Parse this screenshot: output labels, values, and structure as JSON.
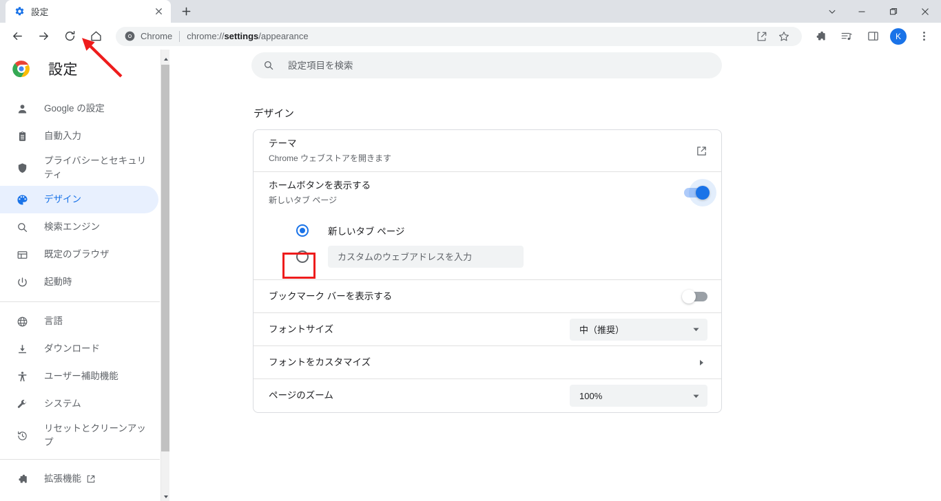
{
  "window": {
    "controls": {
      "tab_search": "tab-search",
      "minimize": "minimize",
      "maximize": "maximize",
      "close": "close"
    }
  },
  "tabstrip": {
    "tabs": [
      {
        "title": "設定",
        "favicon": "gear-icon",
        "active": true
      }
    ],
    "new_tab_label": "+",
    "close_label": "×"
  },
  "toolbar": {
    "back": "back-icon",
    "forward": "forward-icon",
    "reload": "reload-icon",
    "home": "home-icon",
    "omnibox": {
      "brand": "Chrome",
      "url_prefix": "chrome://",
      "url_bold": "settings",
      "url_suffix": "/appearance",
      "full_url": "chrome://settings/appearance"
    },
    "actions": {
      "share": "share-icon",
      "bookmark": "star-icon",
      "extensions": "puzzle-icon",
      "media": "media-list-icon",
      "side_panel": "side-panel-icon",
      "profile_initial": "K",
      "menu": "three-dot-menu-icon"
    }
  },
  "sidebar": {
    "brand_title": "設定",
    "groups": [
      {
        "items": [
          {
            "label": "Google の設定",
            "icon": "person-icon",
            "active": false
          },
          {
            "label": "自動入力",
            "icon": "clipboard-icon",
            "active": false
          },
          {
            "label": "プライバシーとセキュリティ",
            "icon": "shield-icon",
            "active": false
          },
          {
            "label": "デザイン",
            "icon": "palette-icon",
            "active": true
          },
          {
            "label": "検索エンジン",
            "icon": "search-icon",
            "active": false
          },
          {
            "label": "既定のブラウザ",
            "icon": "browser-window-icon",
            "active": false
          },
          {
            "label": "起動時",
            "icon": "power-icon",
            "active": false
          }
        ]
      },
      {
        "items": [
          {
            "label": "言語",
            "icon": "globe-icon",
            "active": false
          },
          {
            "label": "ダウンロード",
            "icon": "download-icon",
            "active": false
          },
          {
            "label": "ユーザー補助機能",
            "icon": "accessibility-icon",
            "active": false
          },
          {
            "label": "システム",
            "icon": "wrench-icon",
            "active": false
          },
          {
            "label": "リセットとクリーンアップ",
            "icon": "restore-icon",
            "active": false
          }
        ]
      },
      {
        "items": [
          {
            "label": "拡張機能",
            "icon": "puzzle-icon",
            "external": true,
            "active": false
          }
        ]
      }
    ]
  },
  "main": {
    "search": {
      "placeholder": "設定項目を検索",
      "value": "",
      "icon": "search-icon"
    },
    "section_title": "デザイン",
    "rows": {
      "theme": {
        "title": "テーマ",
        "subtitle": "Chrome ウェブストアを開きます",
        "action_icon": "external-link-icon"
      },
      "home_button": {
        "title": "ホームボタンを表示する",
        "subtitle": "新しいタブ ページ",
        "toggle_state": "on"
      },
      "home_options": {
        "option_new_tab": "新しいタブ ページ",
        "option_new_tab_selected": true,
        "option_custom_selected": false,
        "custom_placeholder": "カスタムのウェブアドレスを入力",
        "custom_value": ""
      },
      "bookmarks_bar": {
        "title": "ブックマーク バーを表示する",
        "toggle_state": "off"
      },
      "font_size": {
        "title": "フォントサイズ",
        "value": "中（推奨）"
      },
      "customize_fonts": {
        "title": "フォントをカスタマイズ",
        "action_icon": "chevron-right-icon"
      },
      "page_zoom": {
        "title": "ページのズーム",
        "value": "100%"
      }
    }
  },
  "annotations": {
    "arrow_color": "#ee1c1c",
    "highlight_color": "#ee1c1c",
    "arrow_target": "home-icon",
    "highlight_target": "custom-url-radio"
  },
  "colors": {
    "accent": "#1a73e8",
    "active_nav_bg": "#e8f0fe",
    "tabstrip_bg": "#dee1e6",
    "field_bg": "#f1f3f4",
    "border": "#dadce0",
    "text_primary": "#202124",
    "text_secondary": "#5f6368"
  }
}
